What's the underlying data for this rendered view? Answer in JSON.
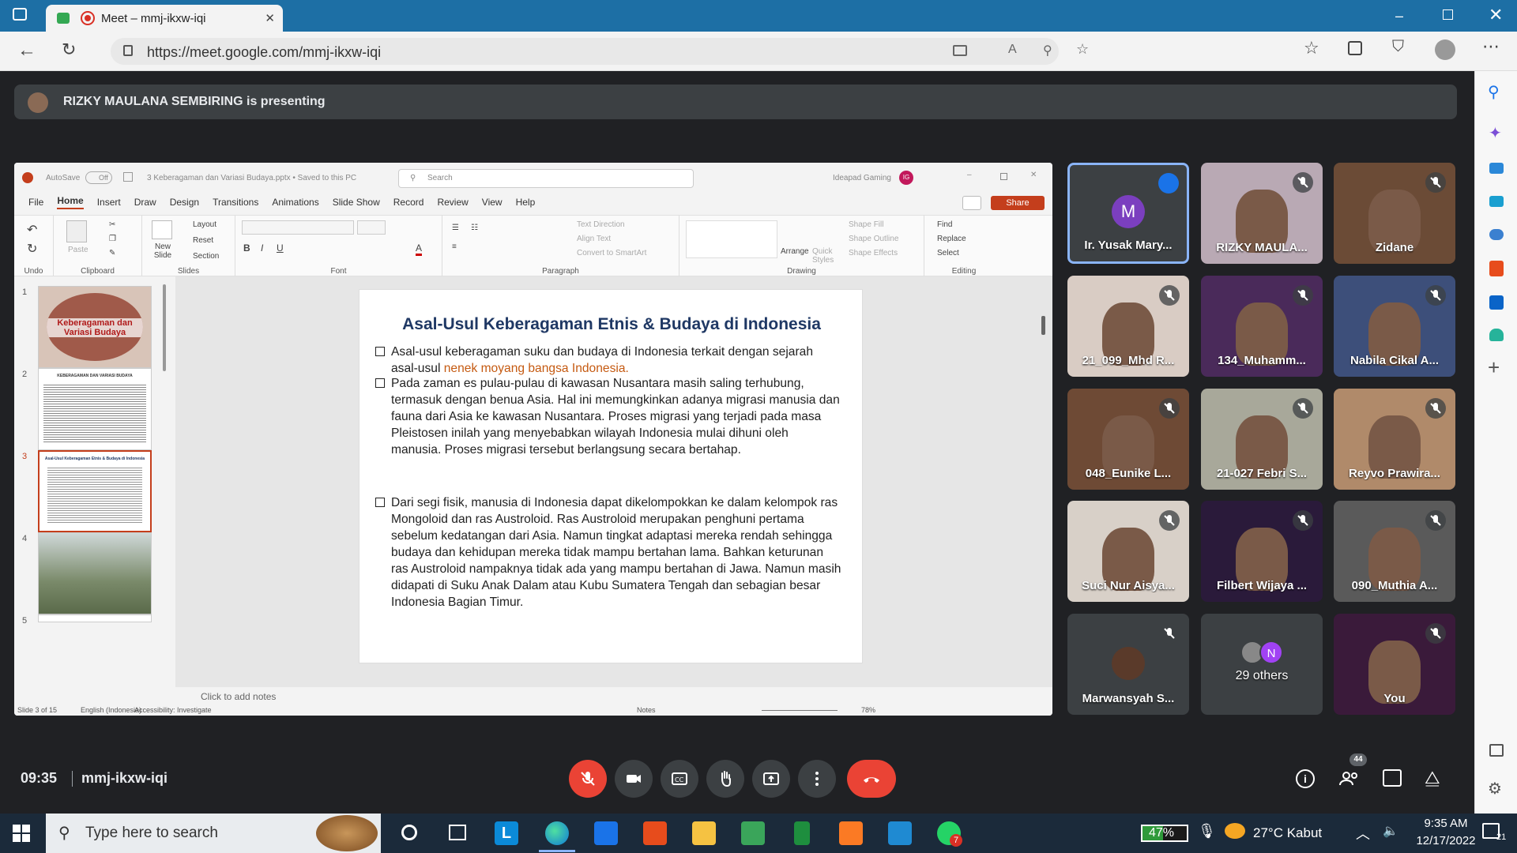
{
  "browser": {
    "tab_title": "Meet – mmj-ikxw-iqi",
    "url": "https://meet.google.com/mmj-ikxw-iqi"
  },
  "banner": {
    "text": "RIZKY MAULANA SEMBIRING is presenting"
  },
  "ppt": {
    "autosave": "AutoSave",
    "autosave_state": "Off",
    "file_title": "3 Keberagaman dan Variasi Budaya.pptx • Saved to this PC",
    "search_placeholder": "Search",
    "account": "Ideapad Gaming",
    "account_initial": "IG",
    "menu": [
      "File",
      "Home",
      "Insert",
      "Draw",
      "Design",
      "Transitions",
      "Animations",
      "Slide Show",
      "Record",
      "Review",
      "View",
      "Help"
    ],
    "share": "Share",
    "ribbon": {
      "undo": "Undo",
      "clipboard": "Clipboard",
      "paste": "Paste",
      "new_slide": "New Slide",
      "layout": "Layout",
      "reset": "Reset",
      "section": "Section",
      "slides": "Slides",
      "font": "Font",
      "paragraph": "Paragraph",
      "text_direction": "Text Direction",
      "align_text": "Align Text",
      "convert_smartart": "Convert to SmartArt",
      "drawing": "Drawing",
      "arrange": "Arrange",
      "quick_styles": "Quick Styles",
      "shape_fill": "Shape Fill",
      "shape_outline": "Shape Outline",
      "shape_effects": "Shape Effects",
      "find": "Find",
      "replace": "Replace",
      "select": "Select",
      "editing": "Editing"
    },
    "thumbs": [
      {
        "n": "1",
        "title": "Keberagaman dan Variasi Budaya"
      },
      {
        "n": "2",
        "title": "KEBERAGAMAN DAN VARIASI BUDAYA"
      },
      {
        "n": "3",
        "title": "Asal-Usul Keberagaman Etnis & Budaya di Indonesia"
      },
      {
        "n": "4",
        "title": ""
      },
      {
        "n": "5",
        "title": ""
      }
    ],
    "slide": {
      "title": "Asal-Usul Keberagaman Etnis & Budaya di Indonesia",
      "b1_a": "Asal-usul keberagaman suku dan budaya di Indonesia terkait dengan sejarah asal-usul ",
      "b1_b": "nenek moyang bangsa Indonesia.",
      "b2": "Pada zaman es pulau-pulau di kawasan Nusantara masih saling terhubung, termasuk dengan benua Asia. Hal ini memungkinkan adanya migrasi manusia dan fauna dari Asia ke kawasan Nusantara. Proses migrasi yang terjadi pada masa Pleistosen inilah yang menyebabkan wilayah Indonesia mulai dihuni oleh manusia. Proses migrasi tersebut berlangsung secara bertahap.",
      "b3": "Dari segi fisik, manusia di Indonesia dapat dikelompokkan ke dalam kelompok ras Mongoloid dan ras Austroloid. Ras Austroloid merupakan penghuni pertama sebelum kedatangan dari Asia. Namun tingkat adaptasi mereka rendah sehingga budaya dan kehidupan mereka tidak mampu bertahan lama. Bahkan keturunan ras Austroloid nampaknya tidak ada yang mampu bertahan di Jawa. Namun masih didapati di Suku Anak Dalam atau Kubu Sumatera Tengah dan sebagian besar Indonesia Bagian Timur."
    },
    "notes": "Click to add notes",
    "status": {
      "slide": "Slide 3 of 15",
      "lang": "English (Indonesia)",
      "access": "Accessibility: Investigate",
      "notes": "Notes",
      "zoom": "78%"
    }
  },
  "tiles": [
    {
      "name": "Ir. Yusak Mary...",
      "initial": "M",
      "kind": "avatar",
      "active": true
    },
    {
      "name": "RIZKY MAULA...",
      "kind": "video",
      "bg": "#b9a9b4",
      "muted": true
    },
    {
      "name": "Zidane",
      "kind": "video",
      "bg": "#6b4b36",
      "muted": true
    },
    {
      "name": "21_099_Mhd R...",
      "kind": "video",
      "bg": "#d9ccc4",
      "muted": true
    },
    {
      "name": "134_Muhamm...",
      "kind": "video",
      "bg": "#4a2a5a",
      "muted": true
    },
    {
      "name": "Nabila Cikal A...",
      "kind": "video",
      "bg": "#3d4f7a",
      "muted": true
    },
    {
      "name": "048_Eunike L...",
      "kind": "video",
      "bg": "#6e4a35",
      "muted": true
    },
    {
      "name": "21-027 Febri S...",
      "kind": "video",
      "bg": "#a8a89a",
      "muted": true
    },
    {
      "name": "Reyvo Prawira...",
      "kind": "video",
      "bg": "#b08a6a",
      "muted": true
    },
    {
      "name": "Suci Nur Aisya...",
      "kind": "video",
      "bg": "#d8d0c8",
      "muted": true
    },
    {
      "name": "Filbert Wijaya ...",
      "kind": "video",
      "bg": "#2a1a3a",
      "muted": true
    },
    {
      "name": "090_Muthia A...",
      "kind": "video",
      "bg": "#5a5a5a",
      "muted": true
    },
    {
      "name": "Marwansyah S...",
      "kind": "avatar-small",
      "muted": true
    },
    {
      "name": "29 others",
      "kind": "others",
      "initial": "N"
    },
    {
      "name": "You",
      "kind": "video",
      "bg": "#3a1a3a",
      "muted": true
    }
  ],
  "meeting": {
    "time": "09:35",
    "code": "mmj-ikxw-iqi",
    "people_count": "44"
  },
  "taskbar": {
    "search": "Type here to search",
    "battery": "47%",
    "weather": "27°C  Kabut",
    "clock_time": "9:35 AM",
    "clock_date": "12/17/2022",
    "notif": "21",
    "whatsapp_badge": "7"
  },
  "colors": {
    "end_call": "#ea4335",
    "mic_off": "#ea4335",
    "taskbar": "#1b2a3a",
    "accent": "#8ab4f8"
  }
}
